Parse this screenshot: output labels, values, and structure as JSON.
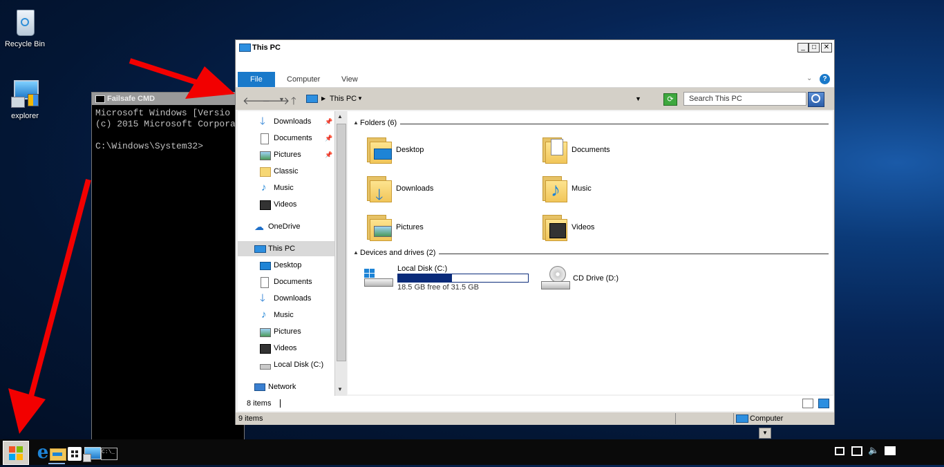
{
  "desktop": {
    "icons": [
      {
        "label": "Recycle Bin",
        "icon": "recycle-bin-icon"
      },
      {
        "label": "explorer",
        "icon": "explorer-icon"
      }
    ]
  },
  "cmd": {
    "title": "Failsafe CMD",
    "lines": [
      "Microsoft Windows [Versio",
      "(c) 2015 Microsoft Corpora",
      "",
      "C:\\Windows\\System32>"
    ]
  },
  "explorer": {
    "title": "This PC",
    "window_buttons": {
      "minimize": "_",
      "maximize": "□",
      "close": "✕"
    },
    "ribbon_tabs": [
      "File",
      "Computer",
      "View"
    ],
    "help": "?",
    "address": {
      "location": "This PC"
    },
    "search": {
      "placeholder": "Search This PC"
    },
    "nav_pane": {
      "quick_access": [
        "Downloads",
        "Documents",
        "Pictures",
        "Classic",
        "Music",
        "Videos"
      ],
      "onedrive": "OneDrive",
      "this_pc": "This PC",
      "this_pc_children": [
        "Desktop",
        "Documents",
        "Downloads",
        "Music",
        "Pictures",
        "Videos",
        "Local Disk (C:)"
      ],
      "network": "Network"
    },
    "groups": {
      "folders": {
        "header": "Folders (6)",
        "items": [
          "Desktop",
          "Documents",
          "Downloads",
          "Music",
          "Pictures",
          "Videos"
        ]
      },
      "devices": {
        "header": "Devices and drives (2)",
        "local_disk": {
          "name": "Local Disk (C:)",
          "free_text": "18.5 GB free of 31.5 GB",
          "used_fraction": 0.413
        },
        "cd_drive": {
          "name": "CD Drive (D:)"
        }
      }
    },
    "inner_status": {
      "count": "8 items"
    },
    "status": {
      "items": "9 items",
      "location": "Computer"
    }
  },
  "colors": {
    "accent": "#1979ca",
    "arrow": "#f20000",
    "drive_bar": "#0a2b7a"
  }
}
